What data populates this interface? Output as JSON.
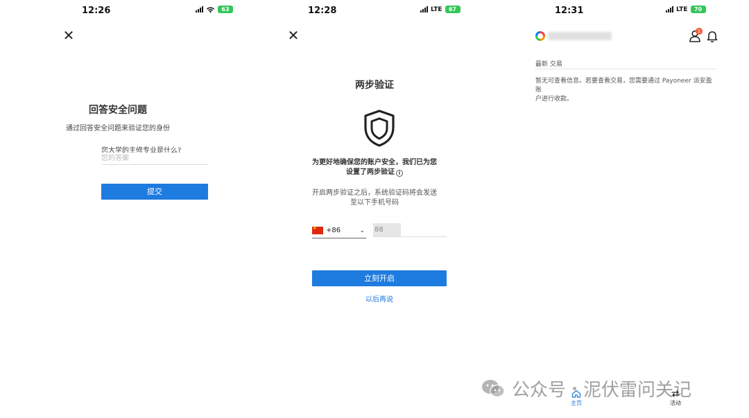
{
  "screen1": {
    "time": "12:26",
    "battery": "63",
    "title": "回答安全问题",
    "subtitle": "通过回答安全问题来验证您的身份",
    "question": "您大学的主修专业是什么?",
    "answer_placeholder": "您的答案",
    "submit_label": "提交"
  },
  "screen2": {
    "time": "12:28",
    "network": "LTE",
    "battery": "67",
    "title": "两步验证",
    "message_bold_line1": "为更好地确保您的账户安全，我们已为您",
    "message_bold_line2": "设置了两步验证",
    "info_glyph": "i",
    "message_line1": "开启两步验证之后，系统验证码将会发送",
    "message_line2": "至以下手机号码",
    "country_code": "+86",
    "phone_value": "88",
    "enable_label": "立刻开启",
    "later_label": "以后再说"
  },
  "screen3": {
    "time": "12:31",
    "network": "LTE",
    "battery": "70",
    "notification_count": "1",
    "section_label": "最新 交易",
    "info_line1": "暂无可查看信息。若要查看交易，您需要通过 Payoneer 派安盈账",
    "info_line2": "户进行收款。",
    "tabs": [
      {
        "label": "主页",
        "icon": "home-icon"
      },
      {
        "label": "活动",
        "icon": "activity-icon"
      }
    ]
  },
  "watermark": {
    "part1": "公众号",
    "part2": "泥伏雷问关记"
  },
  "colors": {
    "primary": "#1e7be0",
    "battery": "#34c759",
    "badge": "#f25c3b"
  }
}
